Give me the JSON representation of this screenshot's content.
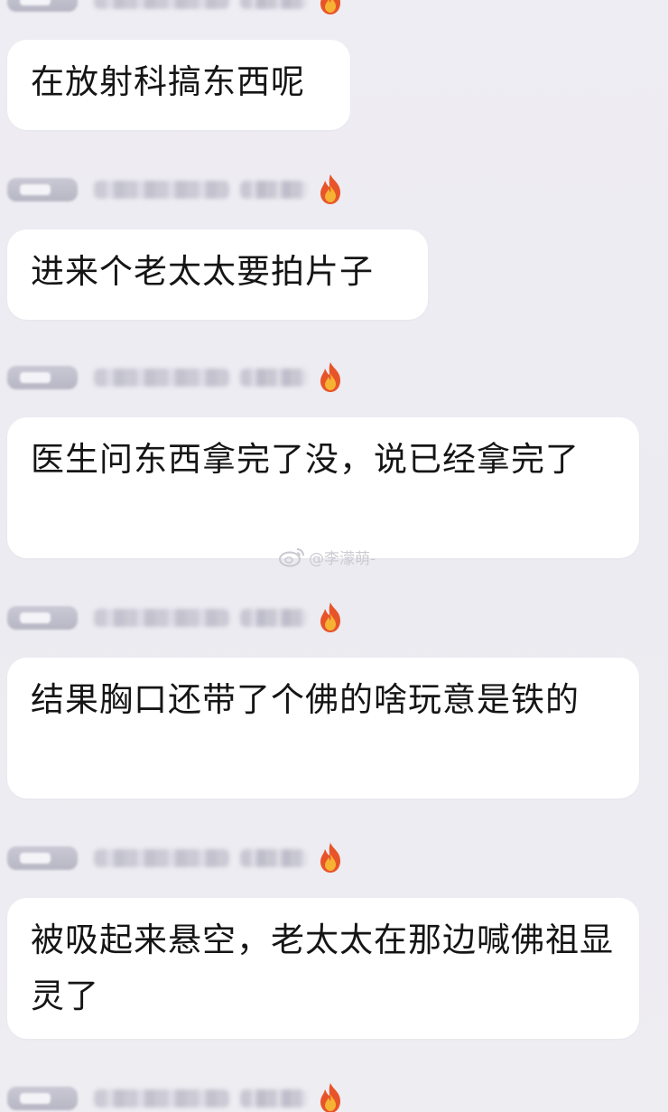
{
  "messages": [
    {
      "text": "在放射科搞东西呢"
    },
    {
      "text": "进来个老太太要拍片子"
    },
    {
      "text": "医生问东西拿完了没，说已经拿完了"
    },
    {
      "text": "结果胸口还带了个佛的啥玩意是铁的"
    },
    {
      "text": "被吸起来悬空，老太太在那边喊佛祖显灵了"
    }
  ],
  "watermark": {
    "text": "@李濛萌-",
    "icon": "weibo-icon"
  },
  "icons": {
    "badge": "level-badge",
    "flame": "fire-icon"
  },
  "colors": {
    "background": "#eeedf3",
    "bubble": "#ffffff",
    "text": "#151515",
    "flame_outer": "#e8542a",
    "flame_inner": "#f6b233"
  }
}
